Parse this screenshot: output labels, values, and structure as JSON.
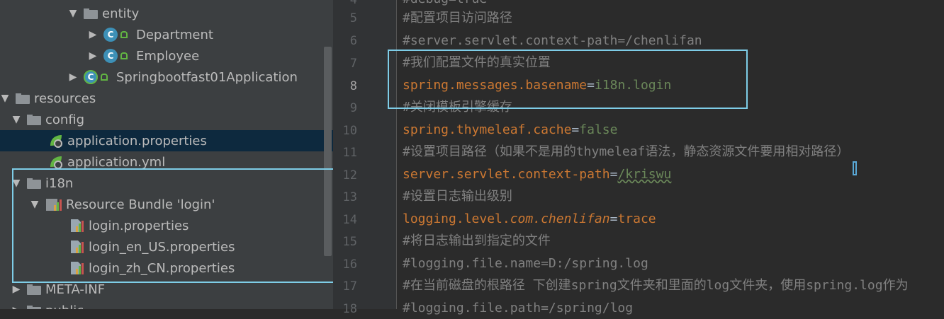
{
  "project_tree": {
    "items": [
      {
        "label": "entity",
        "kind": "package"
      },
      {
        "label": "Department",
        "kind": "class"
      },
      {
        "label": "Employee",
        "kind": "class"
      },
      {
        "label": "Springbootfast01Application",
        "kind": "spring-class"
      },
      {
        "label": "resources",
        "kind": "folder"
      },
      {
        "label": "config",
        "kind": "folder"
      },
      {
        "label": "application.properties",
        "kind": "spring-file",
        "selected": true
      },
      {
        "label": "application.yml",
        "kind": "spring-file"
      },
      {
        "label": "i18n",
        "kind": "folder"
      },
      {
        "label": "Resource Bundle 'login'",
        "kind": "bundle"
      },
      {
        "label": "login.properties",
        "kind": "properties"
      },
      {
        "label": "login_en_US.properties",
        "kind": "properties"
      },
      {
        "label": "login_zh_CN.properties",
        "kind": "properties"
      },
      {
        "label": "META-INF",
        "kind": "folder"
      },
      {
        "label": "public",
        "kind": "folder"
      }
    ]
  },
  "editor": {
    "current_line": "8",
    "lines": [
      {
        "num": "4",
        "text": "#debug=true"
      },
      {
        "num": "5",
        "text": "#配置项目访问路径"
      },
      {
        "num": "6",
        "text": "#server.servlet.context-path=/chenlifan"
      },
      {
        "num": "7",
        "text": "#我们配置文件的真实位置"
      },
      {
        "num": "8",
        "key": "spring.messages.basename",
        "eq": "=",
        "value": "i18n.login"
      },
      {
        "num": "9",
        "text": "#关闭模板引擎缓存"
      },
      {
        "num": "10",
        "key": "spring.thymeleaf.cache",
        "eq": "=",
        "value": "false"
      },
      {
        "num": "11",
        "text": "#设置项目路径（如果不是用的thymeleaf语法，静态资源文件要用相对路径）"
      },
      {
        "num": "12",
        "key": "server.servlet.context-path",
        "eq": "=",
        "value": "/kriswu"
      },
      {
        "num": "13",
        "text": "#设置日志输出级别"
      },
      {
        "num": "14",
        "key": "logging.level.",
        "key_italic": "com.chenlifan",
        "eq": "=",
        "value": "trace"
      },
      {
        "num": "15",
        "text": "#将日志输出到指定的文件"
      },
      {
        "num": "16",
        "text": "#logging.file.name=D:/spring.log"
      },
      {
        "num": "17",
        "text": "#在当前磁盘的根路径 下创建spring文件夹和里面的log文件夹，使用spring.log作为"
      },
      {
        "num": "18",
        "text": "#logging.file.path=/spring/log"
      }
    ]
  },
  "colors": {
    "comment": "#808080",
    "key": "#cc7832",
    "value": "#6a8759",
    "highlight_box": "#7ecde7"
  }
}
